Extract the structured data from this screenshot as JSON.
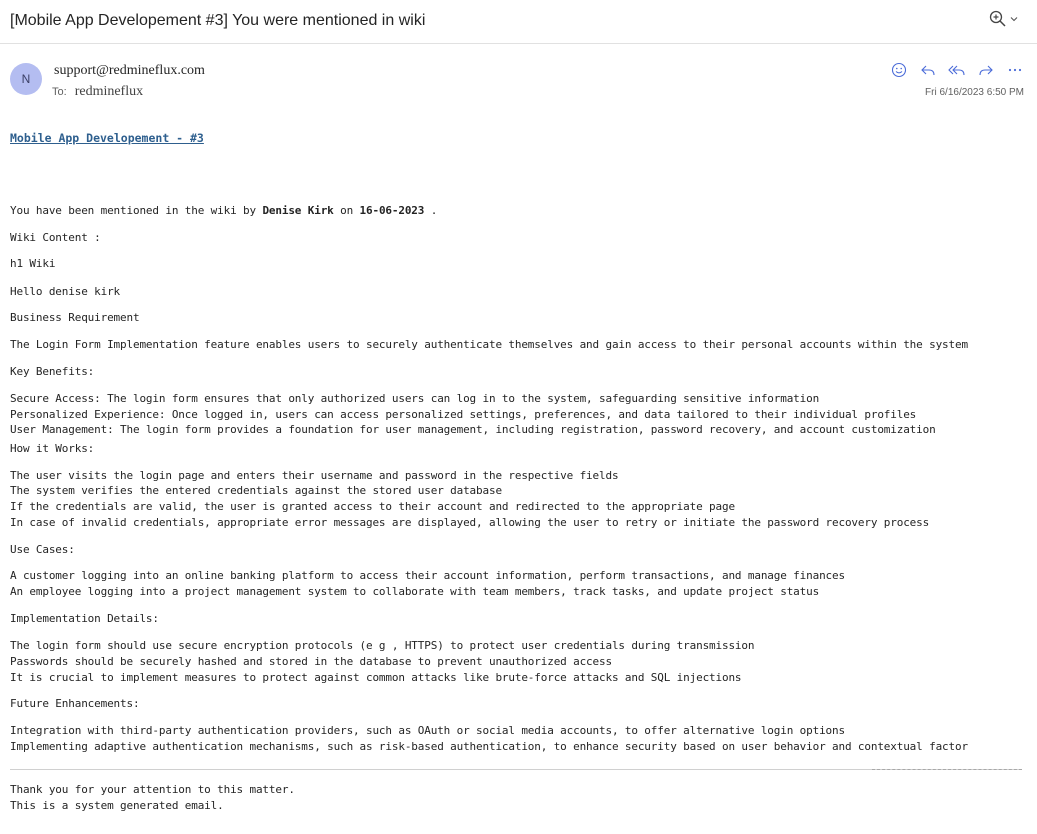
{
  "email": {
    "subject": "[Mobile App Developement #3] You were mentioned in wiki",
    "avatar_initial": "N",
    "from": "support@redmineflux.com",
    "to_label": "To:",
    "to": "redmineflux",
    "date": "Fri 6/16/2023 6:50 PM",
    "icons": {
      "zoom": "zoom-in-icon",
      "emoji": "emoji-icon",
      "reply": "reply-icon",
      "reply_all": "reply-all-icon",
      "forward": "forward-icon",
      "more": "more-icon"
    }
  },
  "content": {
    "link": "Mobile App Developement - #3",
    "mention_prefix": "You have been mentioned in the wiki by ",
    "mention_author": "Denise Kirk",
    "mention_on": " on ",
    "mention_date": "16-06-2023",
    "mention_suffix": " .",
    "wiki_content_label": "Wiki Content :",
    "h1": "h1 Wiki",
    "hello": "Hello denise kirk",
    "business_requirement": "Business Requirement",
    "intro": "The Login Form Implementation feature enables users to securely authenticate themselves and gain access to their personal accounts within the system",
    "key_benefits_label": "Key Benefits:",
    "key_benefits": [
      "Secure Access: The login form ensures that only authorized users can log in to the system, safeguarding sensitive information",
      "Personalized Experience: Once logged in, users can access personalized settings, preferences, and data tailored to their individual profiles",
      "User Management: The login form provides a foundation for user management, including registration, password recovery, and account customization"
    ],
    "how_it_works_label": "How it Works:",
    "how_it_works": [
      "The user visits the login page and enters their username and password in the respective fields",
      "The system verifies the entered credentials against the stored user database",
      "If the credentials are valid, the user is granted access to their account and redirected to the appropriate page",
      "In case of invalid credentials, appropriate error messages are displayed, allowing the user to retry or initiate the password recovery process"
    ],
    "use_cases_label": "Use Cases:",
    "use_cases": [
      "A customer logging into an online banking platform to access their account information, perform transactions, and manage finances",
      "An employee logging into a project management system to collaborate with team members, track tasks, and update project status"
    ],
    "implementation_label": "Implementation Details:",
    "implementation": [
      "The login form should use secure encryption protocols (e g , HTTPS) to protect user credentials during transmission",
      "Passwords should be securely hashed and stored in the database to prevent unauthorized access",
      "It is crucial to implement measures to protect against common attacks like brute-force attacks and SQL injections"
    ],
    "future_label": "Future Enhancements:",
    "future": [
      "Integration with third-party authentication providers, such as OAuth or social media accounts, to offer alternative login options",
      "Implementing adaptive authentication mechanisms, such as risk-based authentication, to enhance security based on user behavior and contextual factor"
    ],
    "thanks": "Thank you for your attention to this matter.",
    "system_generated": "This is a system generated email."
  }
}
